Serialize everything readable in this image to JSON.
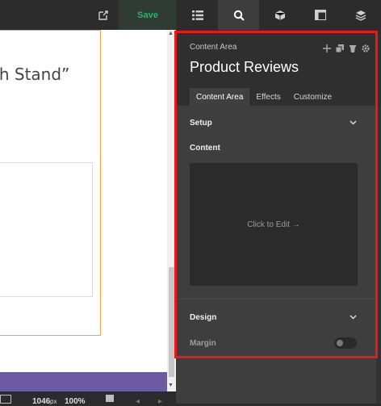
{
  "toolbar": {
    "save_label": "Save",
    "icons": [
      "external-link-icon",
      "list-icon",
      "search-icon",
      "cube-icon",
      "layout-icon",
      "layers-icon"
    ]
  },
  "canvas": {
    "heading": "th Stand”"
  },
  "bottom_bar": {
    "width_value": "1046",
    "width_unit": "px",
    "zoom": "100%"
  },
  "panel": {
    "label": "Content Area",
    "title": "Product Reviews",
    "tabs": [
      {
        "label": "Content Area",
        "active": true
      },
      {
        "label": "Effects",
        "active": false
      },
      {
        "label": "Customize",
        "active": false
      }
    ],
    "setup_title": "Setup",
    "content_label": "Content",
    "edit_placeholder": "Click to Edit →",
    "design_title": "Design",
    "margin_label": "Margin",
    "margin_toggle_on": false
  }
}
